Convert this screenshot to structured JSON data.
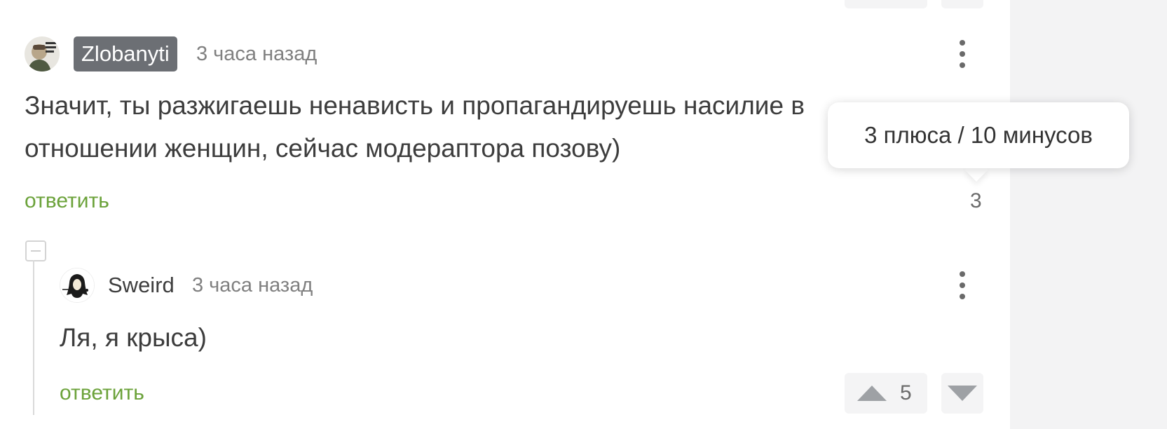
{
  "comment": {
    "username": "Zlobanyti",
    "timestamp": "3 часа назад",
    "text_line1": "Значит, ты разжигаешь ненависть и пропагандируешь насилие в",
    "text_line2": "отношении женщин, сейчас модераптора позову)",
    "reply_label": "ответить",
    "rating": "3",
    "rating_tooltip": "3 плюса / 10 минусов",
    "avatar_icon": "avatar-image"
  },
  "reply": {
    "username": "Sweird",
    "timestamp": "3 часа назад",
    "text": "Ля, я крыса)",
    "reply_label": "ответить",
    "rating": "5",
    "avatar_icon": "avatar-image"
  },
  "icons": {
    "menu": "kebab-menu-icon",
    "upvote": "upvote-triangle-icon",
    "downvote": "downvote-triangle-icon",
    "collapse": "collapse-minus-icon"
  },
  "colors": {
    "reply_link": "#6ba23a",
    "username_badge": "#6c6f74",
    "vote_box": "#f4f4f5"
  }
}
